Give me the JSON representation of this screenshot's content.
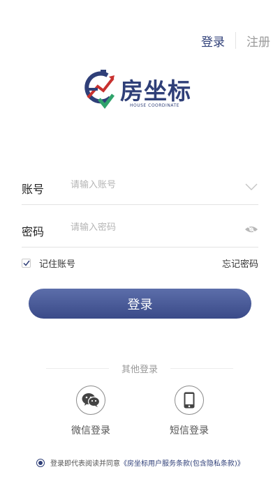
{
  "tabs": {
    "login": "登录",
    "register": "注册"
  },
  "logo": {
    "title": "房坐标",
    "subtitle": "HOUSE COORDINATE"
  },
  "form": {
    "account": {
      "label": "账号",
      "placeholder": "请输入账号",
      "icon": "chevron-down-icon"
    },
    "password": {
      "label": "密码",
      "placeholder": "请输入密码",
      "icon": "eye-icon"
    },
    "remember_label": "记住账号",
    "remember_checked": true,
    "forgot": "忘记密码",
    "submit": "登录"
  },
  "other_login": {
    "title": "其他登录",
    "options": [
      {
        "label": "微信登录",
        "icon": "wechat-icon"
      },
      {
        "label": "短信登录",
        "icon": "phone-icon"
      }
    ]
  },
  "agreement": {
    "text": "登录即代表阅读并同意",
    "link": "《房坐标用户服务条款(包含隐私条款)》",
    "checked": true
  },
  "colors": {
    "brand": "#2f3f78",
    "button_top": "#5c6eaa",
    "button_bottom": "#3a4a88",
    "logo_red": "#c8312f",
    "logo_green": "#2fa36b"
  }
}
